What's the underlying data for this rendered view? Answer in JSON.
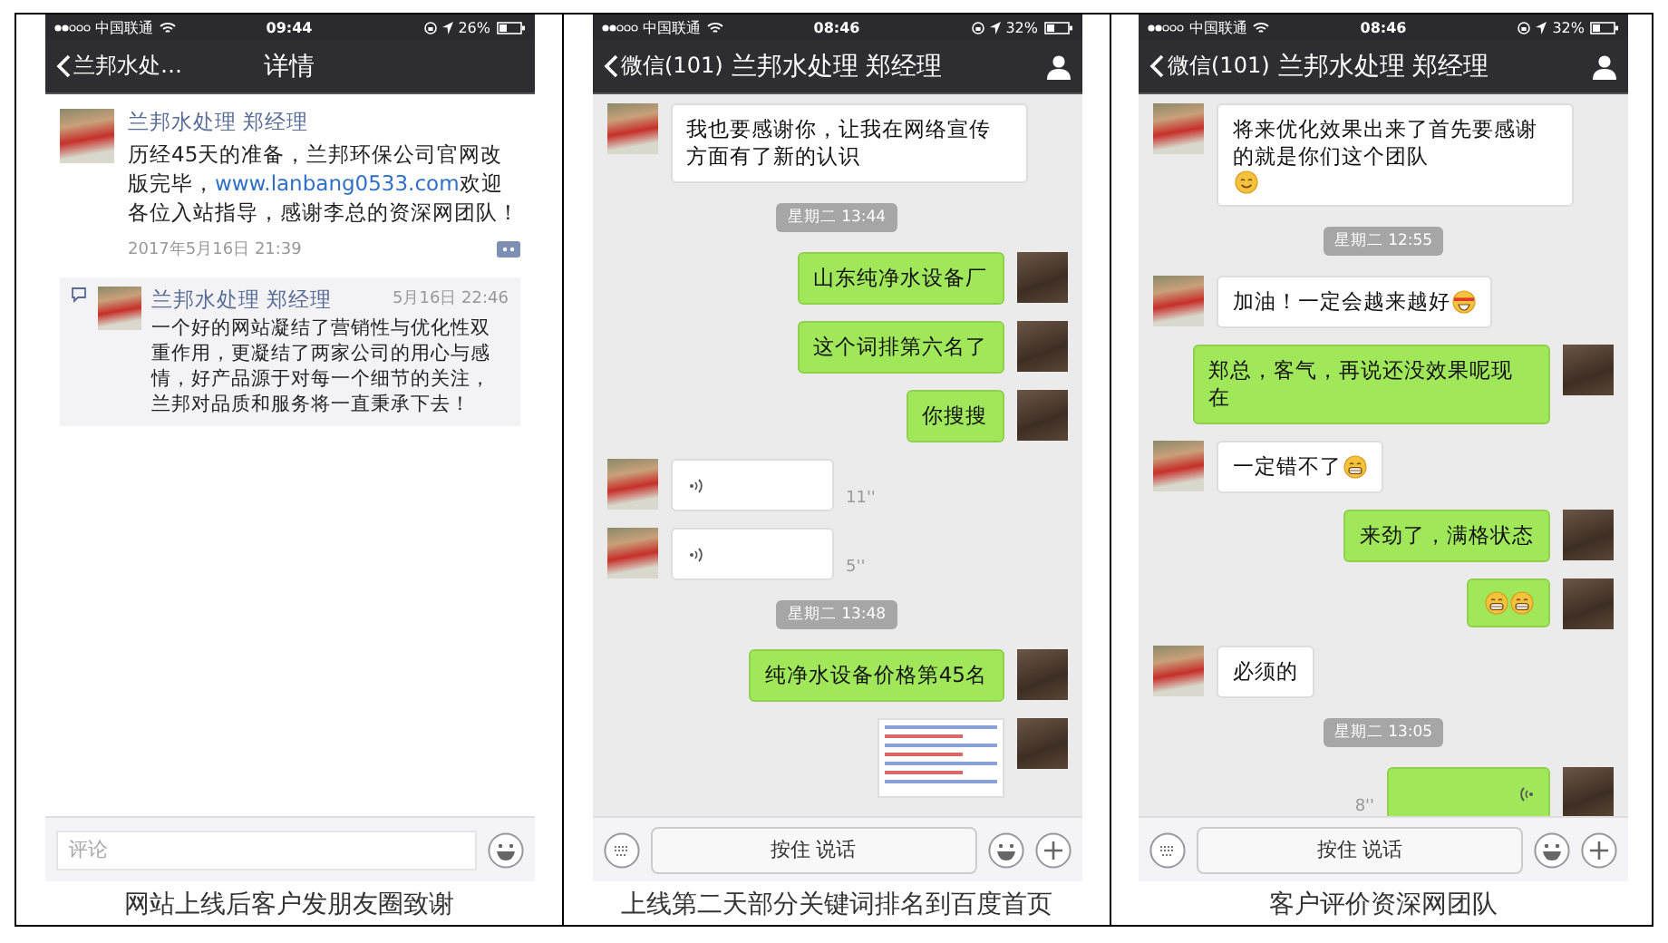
{
  "panels": [
    {
      "kind": "moments",
      "status_bar": {
        "carrier": "中国联通",
        "time": "09:44",
        "battery": "26%"
      },
      "nav": {
        "back": "兰邦水处…",
        "title": "详情"
      },
      "post": {
        "author": "兰邦水处理 郑经理",
        "text_before": "历经45天的准备，兰邦环保公司官网改版完毕，",
        "link": "www.lanbang0533.com",
        "text_after": "欢迎各位入站指导，感谢李总的资深网团队！",
        "date": "2017年5月16日 21:39"
      },
      "comments": [
        {
          "author": "兰邦水处理 郑经理",
          "time": "5月16日 22:46",
          "text": "一个好的网站凝结了营销性与优化性双重作用，更凝结了两家公司的用心与感情，好产品源于对每一个细节的关注，兰邦对品质和服务将一直秉承下去！"
        }
      ],
      "input": {
        "placeholder": "评论"
      },
      "caption": "网站上线后客户发朋友圈致谢"
    },
    {
      "kind": "chat",
      "status_bar": {
        "carrier": "中国联通",
        "time": "08:46",
        "battery": "32%"
      },
      "nav": {
        "back": "微信(101)",
        "title": "兰邦水处理 郑经理"
      },
      "messages": [
        {
          "kind": "text",
          "outgoing": false,
          "text": "我也要感谢你，让我在网络宣传方面有了新的认识"
        },
        {
          "kind": "time",
          "text": "星期二 13:44"
        },
        {
          "kind": "text",
          "outgoing": true,
          "text": "山东纯净水设备厂"
        },
        {
          "kind": "text",
          "outgoing": true,
          "text": "这个词排第六名了"
        },
        {
          "kind": "text",
          "outgoing": true,
          "text": "你搜搜"
        },
        {
          "kind": "voice",
          "outgoing": false,
          "duration": "11''"
        },
        {
          "kind": "voice",
          "outgoing": false,
          "duration": "5''"
        },
        {
          "kind": "time",
          "text": "星期二 13:48"
        },
        {
          "kind": "text",
          "outgoing": true,
          "text": "纯净水设备价格第45名"
        },
        {
          "kind": "image",
          "outgoing": true
        }
      ],
      "input": {
        "button": "按住 说话"
      },
      "caption": "上线第二天部分关键词排名到百度首页"
    },
    {
      "kind": "chat",
      "status_bar": {
        "carrier": "中国联通",
        "time": "08:46",
        "battery": "32%"
      },
      "nav": {
        "back": "微信(101)",
        "title": "兰邦水处理 郑经理"
      },
      "messages": [
        {
          "kind": "text",
          "outgoing": false,
          "text": "将来优化效果出来了首先要感谢的就是你们这个团队",
          "emojis": [
            {
              "kind": "smile"
            }
          ]
        },
        {
          "kind": "time",
          "text": "星期二 12:55"
        },
        {
          "kind": "text",
          "outgoing": false,
          "text": "加油！一定会越来越好",
          "emojis": [
            {
              "kind": "headband"
            }
          ]
        },
        {
          "kind": "text",
          "outgoing": true,
          "text": "郑总，客气，再说还没效果呢现在"
        },
        {
          "kind": "text",
          "outgoing": false,
          "text": "一定错不了",
          "emojis": [
            {
              "kind": "grin"
            }
          ]
        },
        {
          "kind": "text",
          "outgoing": true,
          "text": "来劲了，满格状态"
        },
        {
          "kind": "text",
          "outgoing": true,
          "emojis": [
            {
              "kind": "grin"
            },
            {
              "kind": "grin"
            }
          ]
        },
        {
          "kind": "text",
          "outgoing": false,
          "text": "必须的"
        },
        {
          "kind": "time",
          "text": "星期二 13:05"
        },
        {
          "kind": "voice",
          "outgoing": true,
          "duration": "8''"
        }
      ],
      "input": {
        "button": "按住 说话"
      },
      "caption": "客户评价资深网团队"
    }
  ]
}
